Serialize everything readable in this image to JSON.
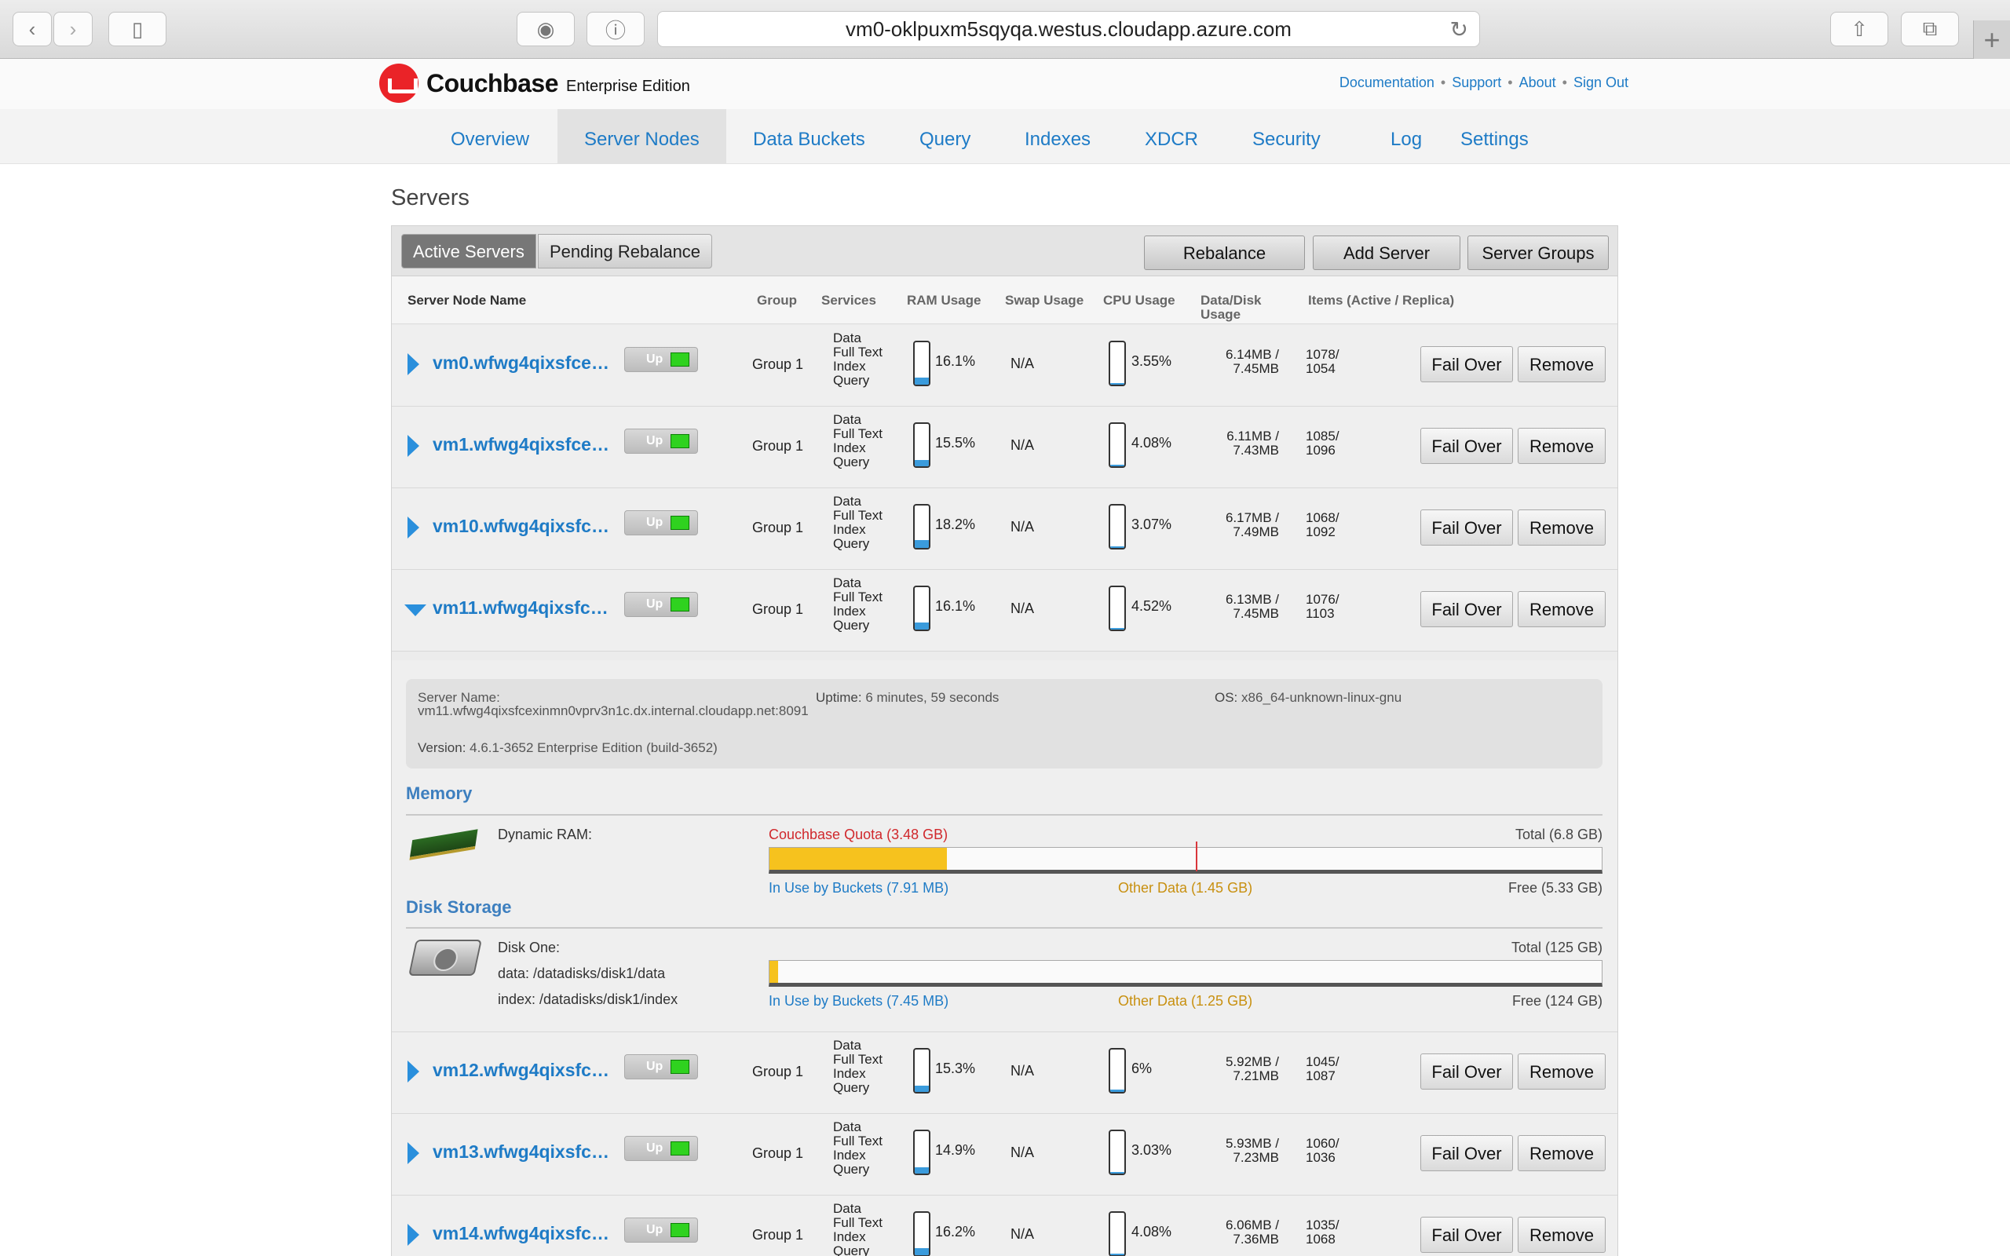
{
  "browser": {
    "url": "vm0-oklpuxm5sqyqa.westus.cloudapp.azure.com",
    "icons": [
      "back-icon",
      "forward-icon",
      "sidebar-icon",
      "stop-icon",
      "info-icon",
      "reload-icon",
      "share-icon",
      "tabs-icon",
      "new-tab-icon"
    ]
  },
  "header": {
    "brand": "Couchbase",
    "edition": "Enterprise Edition",
    "links": [
      "Documentation",
      "Support",
      "About",
      "Sign Out"
    ],
    "separator": "•"
  },
  "nav": {
    "tabs": [
      "Overview",
      "Server Nodes",
      "Data Buckets",
      "Query",
      "Indexes",
      "XDCR",
      "Security",
      "Log",
      "Settings"
    ],
    "active": "Server Nodes"
  },
  "page": {
    "title": "Servers"
  },
  "toolbar": {
    "active_servers": "Active Servers",
    "pending_rebalance": "Pending Rebalance",
    "rebalance": "Rebalance",
    "add_server": "Add Server",
    "server_groups": "Server Groups"
  },
  "table": {
    "headers": {
      "name": "Server Node Name",
      "group": "Group",
      "services": "Services",
      "ram": "RAM Usage",
      "swap": "Swap Usage",
      "cpu": "CPU Usage",
      "disk_1": "Data/Disk",
      "disk_2": "Usage",
      "items": "Items (Active / Replica)"
    },
    "status_label": "Up",
    "fail_over": "Fail Over",
    "remove": "Remove",
    "services": [
      "Data",
      "Full Text",
      "Index",
      "Query"
    ],
    "rows": [
      {
        "name": "vm0.wfwg4qixsfcex...",
        "group": "Group 1",
        "ram": "16.1%",
        "ram_frac": 0.161,
        "swap": "N/A",
        "cpu": "3.55%",
        "cpu_frac": 0.0355,
        "disk_a": "6.14MB /",
        "disk_b": "7.45MB",
        "items_a": "1078/",
        "items_b": "1054",
        "expanded": false
      },
      {
        "name": "vm1.wfwg4qixsfcex...",
        "group": "Group 1",
        "ram": "15.5%",
        "ram_frac": 0.155,
        "swap": "N/A",
        "cpu": "4.08%",
        "cpu_frac": 0.0408,
        "disk_a": "6.11MB /",
        "disk_b": "7.43MB",
        "items_a": "1085/",
        "items_b": "1096",
        "expanded": false
      },
      {
        "name": "vm10.wfwg4qixsfce...",
        "group": "Group 1",
        "ram": "18.2%",
        "ram_frac": 0.182,
        "swap": "N/A",
        "cpu": "3.07%",
        "cpu_frac": 0.0307,
        "disk_a": "6.17MB /",
        "disk_b": "7.49MB",
        "items_a": "1068/",
        "items_b": "1092",
        "expanded": false
      },
      {
        "name": "vm11.wfwg4qixsfce...",
        "group": "Group 1",
        "ram": "16.1%",
        "ram_frac": 0.161,
        "swap": "N/A",
        "cpu": "4.52%",
        "cpu_frac": 0.0452,
        "disk_a": "6.13MB /",
        "disk_b": "7.45MB",
        "items_a": "1076/",
        "items_b": "1103",
        "expanded": true
      },
      {
        "name": "vm12.wfwg4qixsfce...",
        "group": "Group 1",
        "ram": "15.3%",
        "ram_frac": 0.153,
        "swap": "N/A",
        "cpu": "6%",
        "cpu_frac": 0.06,
        "disk_a": "5.92MB /",
        "disk_b": "7.21MB",
        "items_a": "1045/",
        "items_b": "1087",
        "expanded": false
      },
      {
        "name": "vm13.wfwg4qixsfce...",
        "group": "Group 1",
        "ram": "14.9%",
        "ram_frac": 0.149,
        "swap": "N/A",
        "cpu": "3.03%",
        "cpu_frac": 0.0303,
        "disk_a": "5.93MB /",
        "disk_b": "7.23MB",
        "items_a": "1060/",
        "items_b": "1036",
        "expanded": false
      },
      {
        "name": "vm14.wfwg4qixsfce...",
        "group": "Group 1",
        "ram": "16.2%",
        "ram_frac": 0.162,
        "swap": "N/A",
        "cpu": "4.08%",
        "cpu_frac": 0.0408,
        "disk_a": "6.06MB /",
        "disk_b": "7.36MB",
        "items_a": "1035/",
        "items_b": "1068",
        "expanded": false
      }
    ]
  },
  "details": {
    "server_name_label": "Server Name:",
    "server_name": "vm11.wfwg4qixsfcexinmn0vprv3n1c.dx.internal.cloudapp.net:8091",
    "uptime_label": "Uptime:",
    "uptime": "6 minutes, 59 seconds",
    "os_label": "OS:",
    "os": "x86_64-unknown-linux-gnu",
    "version_label": "Version:",
    "version": "4.6.1-3652 Enterprise Edition (build-3652)",
    "memory": {
      "title": "Memory",
      "label": "Dynamic RAM:",
      "quota": "Couchbase Quota (3.48 GB)",
      "total": "Total (6.8 GB)",
      "in_use": "In Use by Buckets (7.91 MB)",
      "other": "Other Data (1.45 GB)",
      "free": "Free (5.33 GB)",
      "used_frac": 0.213,
      "quota_frac": 0.512
    },
    "disk": {
      "title": "Disk Storage",
      "label": "Disk One:",
      "data_path": "data: /datadisks/disk1/data",
      "index_path": "index: /datadisks/disk1/index",
      "total": "Total (125 GB)",
      "in_use": "In Use by Buckets (7.45 MB)",
      "other": "Other Data (1.25 GB)",
      "free": "Free (124 GB)",
      "used_frac": 0.01
    }
  },
  "colors": {
    "link": "#1e7bc6",
    "brand": "#ea2328",
    "status_up": "#2fd21f",
    "quota": "#d0282c",
    "other_data": "#c89010",
    "bucket_fill": "#f6c21e"
  }
}
